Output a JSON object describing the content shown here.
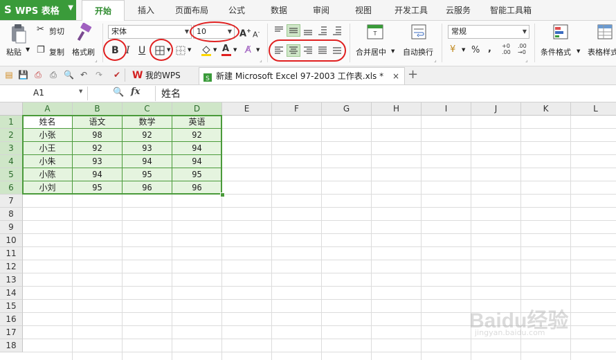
{
  "app": {
    "title": "WPS 表格"
  },
  "menu": {
    "tabs": [
      "开始",
      "插入",
      "页面布局",
      "公式",
      "数据",
      "审阅",
      "视图",
      "开发工具",
      "云服务",
      "智能工具箱"
    ],
    "active": "开始"
  },
  "ribbon": {
    "clipboard": {
      "paste": "粘贴",
      "cut": "剪切",
      "copy": "复制",
      "format_painter": "格式刷"
    },
    "font": {
      "name": "宋体",
      "size": "10",
      "bold": "B",
      "italic": "I",
      "underline": "U",
      "font_color_glyph": "A"
    },
    "alignment": {
      "merge_center": "合并居中",
      "wrap_text": "自动换行"
    },
    "number": {
      "format": "常规",
      "percent": "%",
      "comma": ","
    },
    "styles": {
      "conditional_format": "条件格式",
      "table_style": "表格样式"
    }
  },
  "quick_access": {
    "tabs": [
      {
        "label": "我的WPS"
      },
      {
        "label": "新建 Microsoft Excel 97-2003 工作表.xls *"
      }
    ]
  },
  "formula_bar": {
    "cell_ref": "A1",
    "fx": "fx",
    "content": "姓名"
  },
  "sheet": {
    "columns": [
      "A",
      "B",
      "C",
      "D",
      "E",
      "F",
      "G",
      "H",
      "I",
      "J",
      "K",
      "L"
    ],
    "rows": [
      "1",
      "2",
      "3",
      "4",
      "5",
      "6",
      "7",
      "8",
      "9",
      "10",
      "11",
      "12",
      "13",
      "14",
      "15",
      "16",
      "17",
      "18"
    ],
    "header": [
      "姓名",
      "语文",
      "数学",
      "英语"
    ],
    "data": [
      [
        "小张",
        "98",
        "92",
        "92"
      ],
      [
        "小王",
        "92",
        "93",
        "94"
      ],
      [
        "小朱",
        "93",
        "94",
        "94"
      ],
      [
        "小陈",
        "94",
        "95",
        "95"
      ],
      [
        "小刘",
        "95",
        "96",
        "96"
      ]
    ]
  },
  "colors": {
    "brand": "#3a9b3a",
    "selection_fill": "#e2f3dc",
    "selection_border": "#4a9a3a",
    "annotation": "#e02020"
  },
  "watermark": {
    "text": "Baidu经验",
    "sub": "jingyan.baidu.com"
  }
}
